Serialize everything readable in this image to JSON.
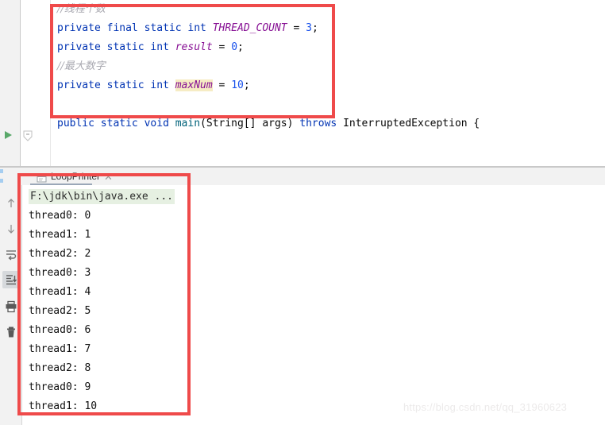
{
  "editor": {
    "gutter": {
      "run_arrow_icon": "run-triangle-icon",
      "fold_marker_icon": "code-fold-icon"
    },
    "code_lines": [
      {
        "id": "comment-thread-count",
        "tokens": [
          {
            "text": "//线程个数",
            "cls": "cmt"
          }
        ]
      },
      {
        "id": "decl-thread-count",
        "tokens": [
          {
            "text": "private",
            "cls": "kw"
          },
          {
            "text": " ",
            "cls": "plain"
          },
          {
            "text": "final",
            "cls": "kw"
          },
          {
            "text": " ",
            "cls": "plain"
          },
          {
            "text": "static",
            "cls": "kw"
          },
          {
            "text": " ",
            "cls": "plain"
          },
          {
            "text": "int",
            "cls": "kw"
          },
          {
            "text": " ",
            "cls": "plain"
          },
          {
            "text": "THREAD_COUNT",
            "cls": "constf"
          },
          {
            "text": " = ",
            "cls": "plain"
          },
          {
            "text": "3",
            "cls": "num"
          },
          {
            "text": ";",
            "cls": "plain"
          }
        ]
      },
      {
        "id": "decl-result",
        "tokens": [
          {
            "text": "private",
            "cls": "kw"
          },
          {
            "text": " ",
            "cls": "plain"
          },
          {
            "text": "static",
            "cls": "kw"
          },
          {
            "text": " ",
            "cls": "plain"
          },
          {
            "text": "int",
            "cls": "kw"
          },
          {
            "text": " ",
            "cls": "plain"
          },
          {
            "text": "result",
            "cls": "fieldv"
          },
          {
            "text": " = ",
            "cls": "plain"
          },
          {
            "text": "0",
            "cls": "num"
          },
          {
            "text": ";",
            "cls": "plain"
          }
        ]
      },
      {
        "id": "comment-max-num",
        "tokens": [
          {
            "text": "//最大数字",
            "cls": "cmt"
          }
        ]
      },
      {
        "id": "decl-max-num",
        "tokens": [
          {
            "text": "private",
            "cls": "kw"
          },
          {
            "text": " ",
            "cls": "plain"
          },
          {
            "text": "static",
            "cls": "kw"
          },
          {
            "text": " ",
            "cls": "plain"
          },
          {
            "text": "int",
            "cls": "kw"
          },
          {
            "text": " ",
            "cls": "plain"
          },
          {
            "text": "maxNum",
            "cls": "fieldhl"
          },
          {
            "text": " = ",
            "cls": "plain"
          },
          {
            "text": "10",
            "cls": "num"
          },
          {
            "text": ";",
            "cls": "plain"
          }
        ]
      },
      {
        "id": "blank-1",
        "tokens": [
          {
            "text": " ",
            "cls": "plain"
          }
        ]
      },
      {
        "id": "main-signature",
        "tokens": [
          {
            "text": "public",
            "cls": "kw"
          },
          {
            "text": " ",
            "cls": "plain"
          },
          {
            "text": "static",
            "cls": "kw"
          },
          {
            "text": " ",
            "cls": "plain"
          },
          {
            "text": "void",
            "cls": "kw"
          },
          {
            "text": " ",
            "cls": "plain"
          },
          {
            "text": "main",
            "cls": "meth"
          },
          {
            "text": "(String[] args) ",
            "cls": "type"
          },
          {
            "text": "throws",
            "cls": "kw"
          },
          {
            "text": " InterruptedException {",
            "cls": "type"
          }
        ]
      }
    ]
  },
  "console": {
    "tab": {
      "label": "LoopPrinter",
      "icon": "console-tab-icon",
      "close_label": "✕"
    },
    "toolbar": [
      {
        "name": "scroll-up-button",
        "icon": "arrow-up-icon",
        "active": false
      },
      {
        "name": "scroll-down-button",
        "icon": "arrow-down-icon",
        "active": false
      },
      {
        "name": "soft-wrap-button",
        "icon": "soft-wrap-icon",
        "active": false
      },
      {
        "name": "scroll-to-end-button",
        "icon": "scroll-to-end-icon",
        "active": true
      },
      {
        "name": "print-button",
        "icon": "printer-icon",
        "active": false
      },
      {
        "name": "clear-all-button",
        "icon": "trash-icon",
        "active": false
      }
    ],
    "command_line": "F:\\jdk\\bin\\java.exe ...",
    "output_lines": [
      "thread0: 0",
      "thread1: 1",
      "thread2: 2",
      "thread0: 3",
      "thread1: 4",
      "thread2: 5",
      "thread0: 6",
      "thread1: 7",
      "thread2: 8",
      "thread0: 9",
      "thread1: 10"
    ]
  },
  "annotations": {
    "box_color": "#ef4a4a",
    "boxes": [
      {
        "name": "red-highlight-fields",
        "target": "static field declarations"
      },
      {
        "name": "red-highlight-output",
        "target": "console output lines"
      }
    ]
  },
  "watermark": {
    "text": "https://blog.csdn.net/qq_31960623"
  }
}
